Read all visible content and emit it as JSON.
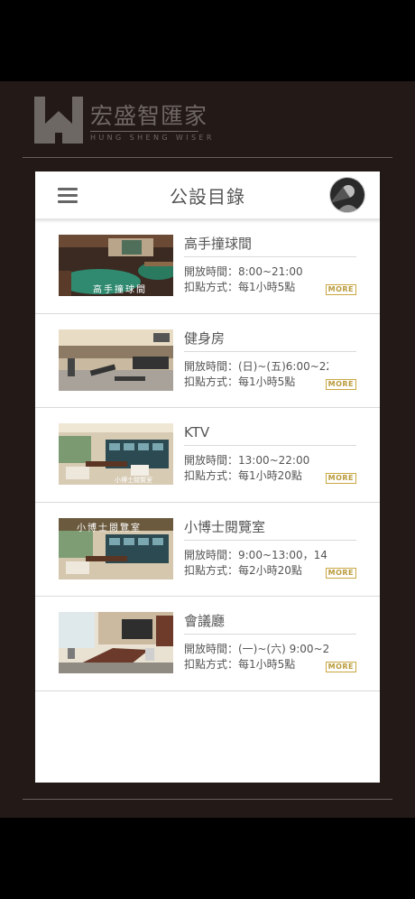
{
  "brand": {
    "name_cn": "宏盛智匯家",
    "name_en": "HUNG SHENG WISER"
  },
  "header": {
    "title": "公設目錄",
    "menu_icon": "hamburger-menu-icon",
    "avatar": "user-avatar"
  },
  "facilities": [
    {
      "name": "高手撞球間",
      "hours": "開放時間：8:00~21:00",
      "points": "扣點方式：每1小時5點",
      "more": "MORE",
      "photo": "billiards-room-photo",
      "caption": "高手撞球間"
    },
    {
      "name": "健身房",
      "hours": "開放時間：(日)~(五)6:00~22",
      "points": "扣點方式：每1小時5點",
      "more": "MORE",
      "photo": "gym-photo",
      "caption": ""
    },
    {
      "name": "KTV",
      "hours": "開放時間：13:00~22:00",
      "points": "扣點方式：每1小時20點",
      "more": "MORE",
      "photo": "ktv-photo",
      "caption": "小博士閱覽室"
    },
    {
      "name": "小博士閱覽室",
      "hours": "開放時間：9:00~13:00，14:(",
      "points": "扣點方式：每2小時20點",
      "more": "MORE",
      "photo": "reading-room-photo",
      "caption": "小博士閱覽室"
    },
    {
      "name": "會議廳",
      "hours": "開放時間：(一)~(六) 9:00~2",
      "points": "扣點方式：每1小時5點",
      "more": "MORE",
      "photo": "meeting-hall-photo",
      "caption": ""
    }
  ],
  "colors": {
    "frame_bg": "#231917",
    "brand_gray": "#6e6865",
    "more_gold": "#c9a640",
    "text": "#555555"
  }
}
